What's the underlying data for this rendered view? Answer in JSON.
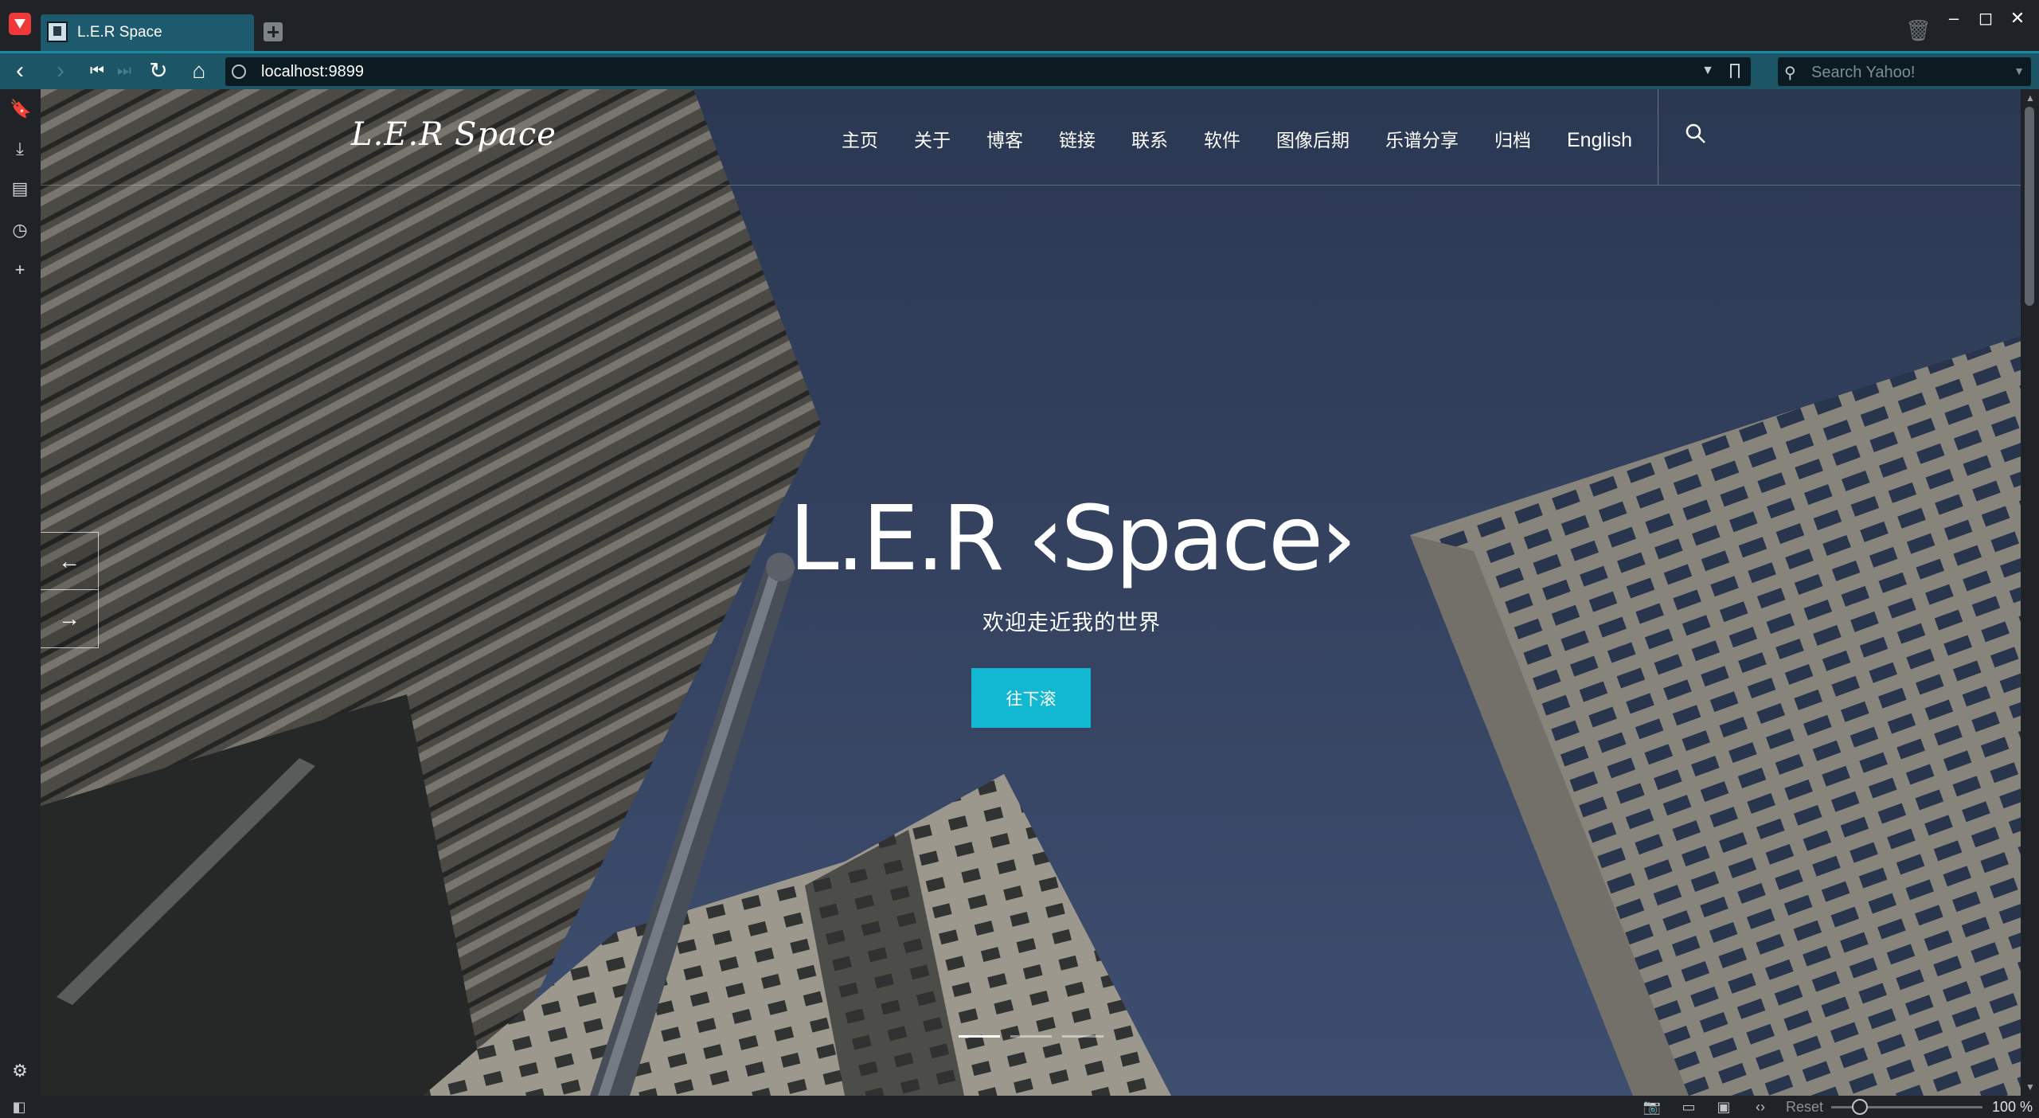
{
  "browser": {
    "tab": {
      "title": "L.E.R Space"
    },
    "url": "localhost:9899",
    "search": {
      "placeholder": "Search Yahoo!"
    },
    "window_controls": {
      "minimize": "–",
      "maximize": "◻",
      "close": "✕"
    },
    "status": {
      "reset_label": "Reset",
      "zoom": "100 %"
    }
  },
  "site": {
    "logo": "L.E.R Space",
    "nav": [
      "主页",
      "关于",
      "博客",
      "链接",
      "联系",
      "软件",
      "图像后期",
      "乐谱分享",
      "归档",
      "English"
    ],
    "hero": {
      "title": "L.E.R ‹Space›",
      "subtitle": "欢迎走近我的世界",
      "button": "往下滚"
    },
    "slider": {
      "prev": "←",
      "next": "→",
      "slide_count": 3,
      "active_slide": 1
    }
  },
  "colors": {
    "accent": "#12b7d1",
    "sky": "#3d4d6d",
    "chrome": "#1f2226",
    "address_bar": "#1c5666",
    "vivaldi_red": "#ef3939"
  }
}
